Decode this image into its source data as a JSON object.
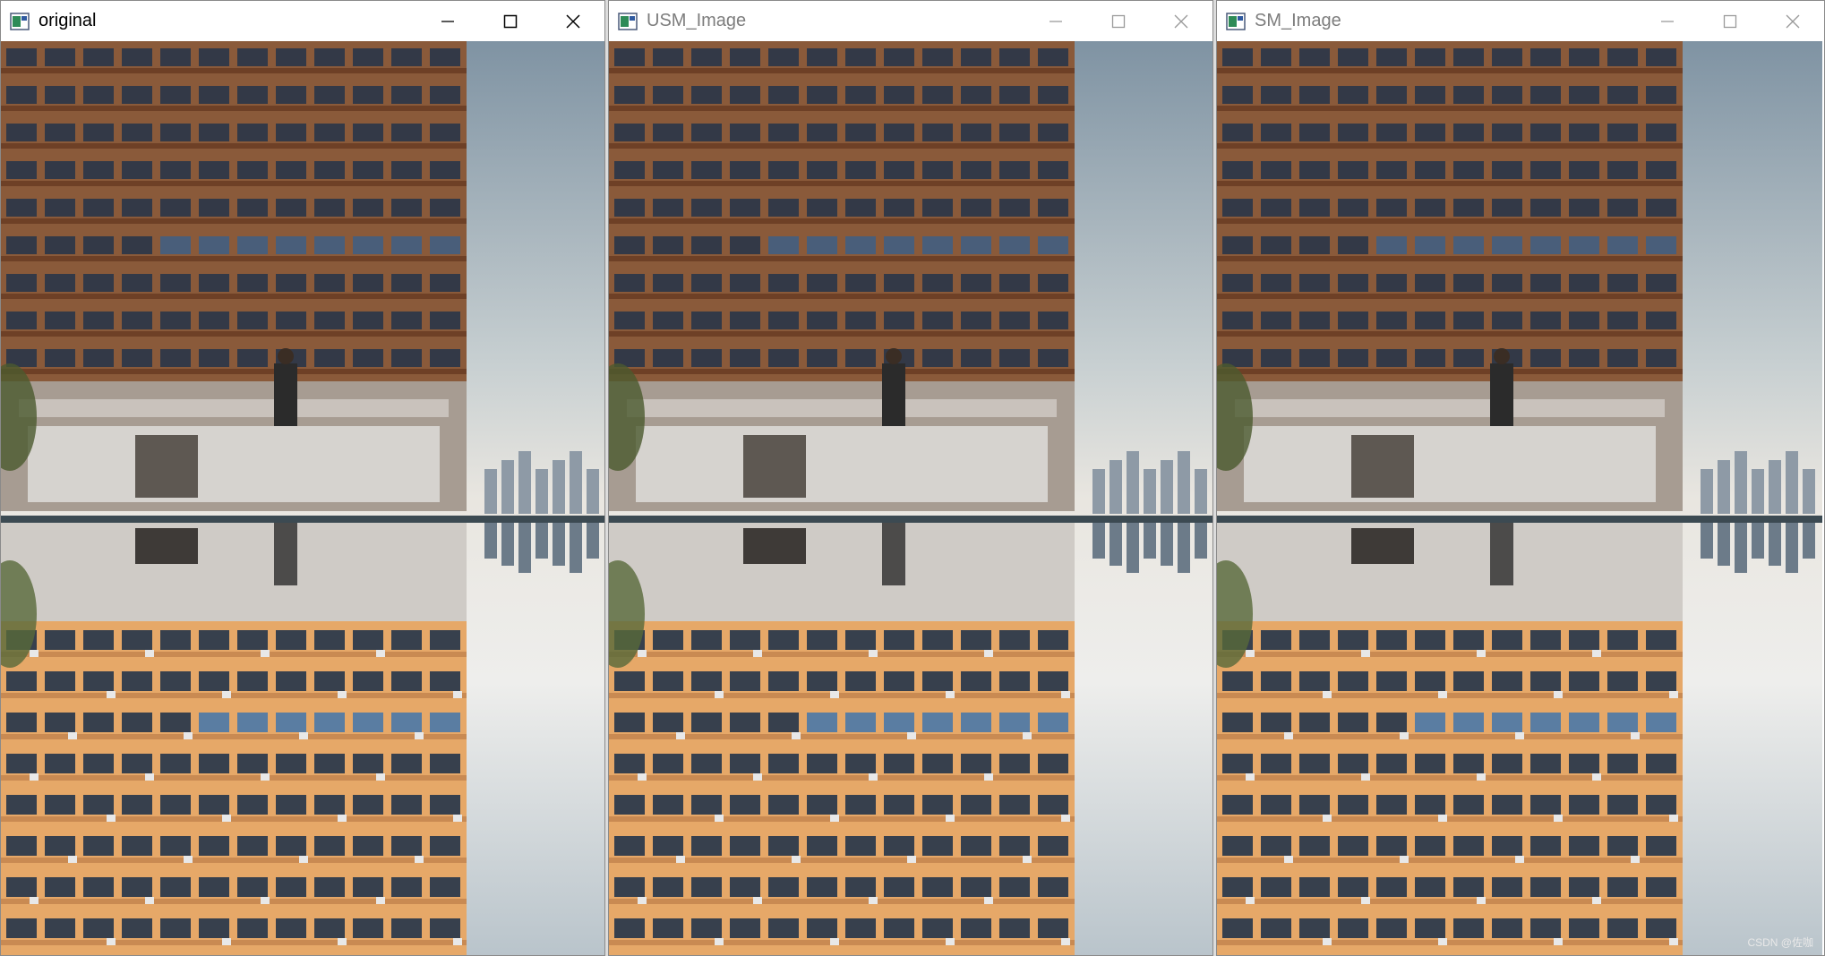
{
  "windows": [
    {
      "title": "original",
      "active": true
    },
    {
      "title": "USM_Image",
      "active": false
    },
    {
      "title": "SM_Image",
      "active": false
    }
  ],
  "image": {
    "description_icon": "window-app-icon",
    "sky_color": "#9fb2c0",
    "facade_top_color": "#8a5a3a",
    "facade_bottom_color": "#e6a868",
    "window_color": "#23344a",
    "water_line_color": "#3c4a52"
  },
  "watermark": "CSDN @佐咖"
}
